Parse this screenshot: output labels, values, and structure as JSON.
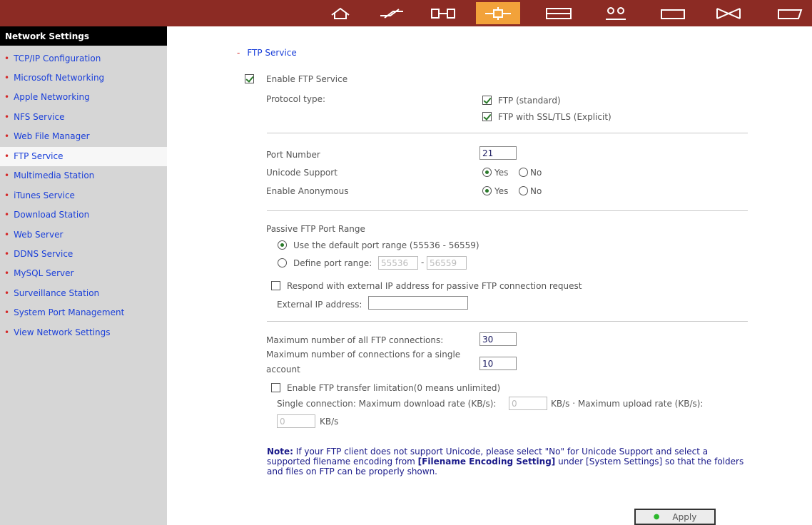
{
  "topbar": {
    "icons": [
      "home-icon",
      "lightning-icon",
      "system-tools-icon",
      "network-icon",
      "disk-icon",
      "users-icon",
      "folder-icon",
      "mail-icon",
      "share-icon"
    ],
    "active_index": 3
  },
  "sidebar": {
    "title": "Network Settings",
    "items": [
      {
        "label": "TCP/IP Configuration"
      },
      {
        "label": "Microsoft Networking"
      },
      {
        "label": "Apple Networking"
      },
      {
        "label": "NFS Service"
      },
      {
        "label": "Web File Manager"
      },
      {
        "label": "FTP Service"
      },
      {
        "label": "Multimedia Station"
      },
      {
        "label": "iTunes Service"
      },
      {
        "label": "Download Station"
      },
      {
        "label": "Web Server"
      },
      {
        "label": "DDNS Service"
      },
      {
        "label": "MySQL Server"
      },
      {
        "label": "Surveillance Station"
      },
      {
        "label": "System Port Management"
      },
      {
        "label": "View Network Settings"
      }
    ],
    "active_index": 5
  },
  "main": {
    "section_title": "FTP Service",
    "enable_ftp": {
      "label": "Enable FTP Service",
      "checked": true
    },
    "protocol": {
      "label": "Protocol type:",
      "ftp_standard": {
        "label": "FTP (standard)",
        "checked": true
      },
      "ftp_ssl": {
        "label": "FTP with SSL/TLS (Explicit)",
        "checked": true
      }
    },
    "port_number": {
      "label": "Port Number",
      "value": "21"
    },
    "unicode": {
      "label": "Unicode Support",
      "yes": "Yes",
      "no": "No",
      "selected": "Yes"
    },
    "anonymous": {
      "label": "Enable Anonymous",
      "yes": "Yes",
      "no": "No",
      "selected": "Yes"
    },
    "passive": {
      "title": "Passive FTP Port Range",
      "default_option": "Use the default port range (55536 - 56559)",
      "define_option": "Define port range:",
      "range_from": "55536",
      "range_sep": "-",
      "range_to": "56559",
      "selected": "default"
    },
    "external_ip": {
      "respond_label": "Respond with external IP address for passive FTP connection request",
      "respond_checked": false,
      "address_label": "External IP address:",
      "address_value": ""
    },
    "max_all": {
      "label": "Maximum number of all FTP connections:",
      "value": "30"
    },
    "max_single": {
      "label_line1": "Maximum number of connections for a single",
      "label_line2": "account",
      "value": "10"
    },
    "transfer_limit": {
      "label": "Enable FTP transfer limitation(0 means unlimited)",
      "checked": false,
      "single_label": "Single connection: Maximum download rate (KB/s):",
      "download_value": "0",
      "kbs_upload_label": "KB/s ‧ Maximum upload rate (KB/s):",
      "upload_value": "0",
      "kbs_label": "KB/s"
    },
    "note": {
      "prefix": "Note:",
      "text1": " If your FTP client does not support Unicode, please select \"No\" for Unicode Support and select a supported filename encoding from ",
      "link": "[Filename Encoding Setting]",
      "text2": " under [System Settings] so that the folders and files on FTP can be properly shown."
    },
    "apply_label": "Apply"
  },
  "colors": {
    "topbar": "#8c2b24",
    "active_tab": "#f2a23a",
    "sidebar": "#d6d6d6",
    "link": "#1a3fd9",
    "bullet": "#d42a2a",
    "check": "#2a7a2a"
  }
}
